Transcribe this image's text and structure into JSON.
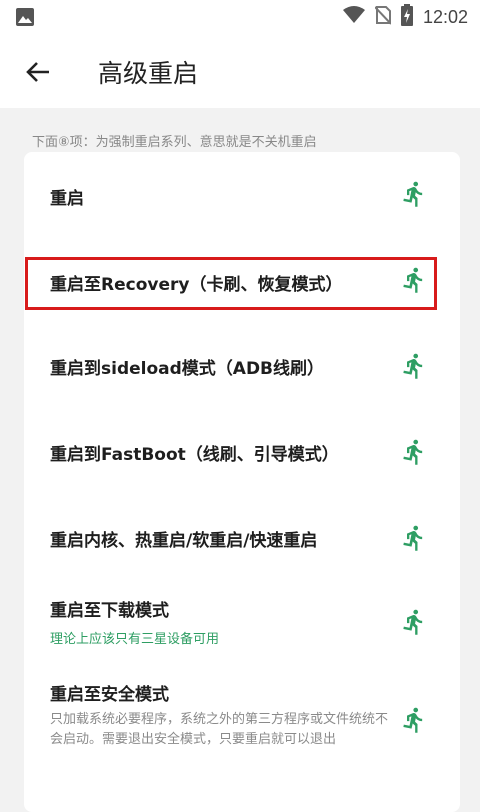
{
  "status_bar": {
    "time": "12:02",
    "icons": [
      "image-icon",
      "wifi-icon",
      "no-sim-icon",
      "battery-charging-icon"
    ]
  },
  "app_bar": {
    "title": "高级重启",
    "back_icon": "arrow-left-icon"
  },
  "hint": "下面⑧项：为强制重启系列、意思就是不关机重启",
  "items": [
    {
      "title": "重启",
      "icon": "running-man-icon"
    },
    {
      "title": "重启至Recovery（卡刷、恢复模式）",
      "icon": "running-man-icon",
      "highlighted": true
    },
    {
      "title": "重启到sideload模式（ADB线刷）",
      "icon": "running-man-icon"
    },
    {
      "title": "重启到FastBoot（线刷、引导模式）",
      "icon": "running-man-icon"
    },
    {
      "title": "重启内核、热重启/软重启/快速重启",
      "icon": "running-man-icon"
    },
    {
      "title": "重启至下载模式",
      "subtitle": "理论上应该只有三星设备可用",
      "icon": "running-man-icon"
    },
    {
      "title": "重启至安全模式",
      "subtitle": "只加载系统必要程序，系统之外的第三方程序或文件统统不会启动。需要退出安全模式，只要重启就可以退出",
      "icon": "running-man-icon"
    }
  ],
  "colors": {
    "accent_green": "#2e9e63",
    "highlight_red": "#d81b1b"
  }
}
